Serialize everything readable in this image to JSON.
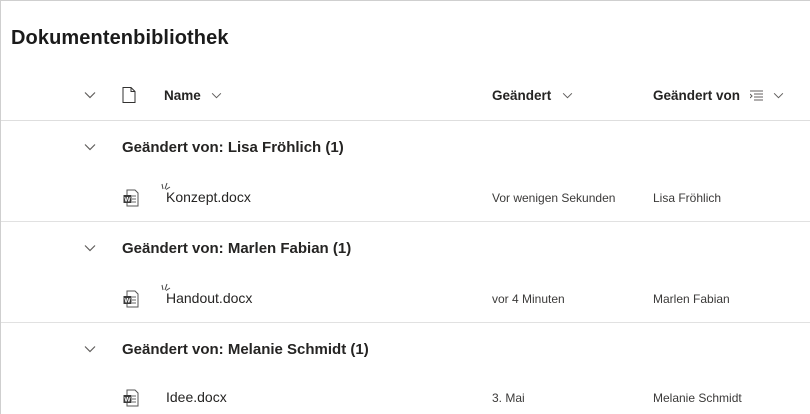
{
  "library": {
    "title": "Dokumentenbibliothek"
  },
  "header": {
    "name_label": "Name",
    "modified_label": "Geändert",
    "modified_by_label": "Geändert von",
    "icons": [
      "chevron-down-icon",
      "document-icon",
      "filter-icon"
    ]
  },
  "groups": [
    {
      "label": "Geändert von: Lisa Fröhlich (1)",
      "file": {
        "name": "Konzept.docx",
        "modified": "Vor wenigen Sekunden",
        "modified_by": "Lisa Fröhlich",
        "icon": "word-file-icon",
        "new_indicator": true
      }
    },
    {
      "label": "Geändert von: Marlen Fabian (1)",
      "file": {
        "name": "Handout.docx",
        "modified": "vor 4 Minuten",
        "modified_by": "Marlen Fabian",
        "icon": "word-file-icon",
        "new_indicator": true
      }
    },
    {
      "label": "Geändert von: Melanie Schmidt (1)",
      "file": {
        "name": "Idee.docx",
        "modified": "3. Mai",
        "modified_by": "Melanie Schmidt",
        "icon": "word-file-icon",
        "new_indicator": false
      }
    }
  ],
  "colors": {
    "word_icon": "#3a3a3a",
    "divider": "#e1e1e1",
    "text": "#252423"
  }
}
